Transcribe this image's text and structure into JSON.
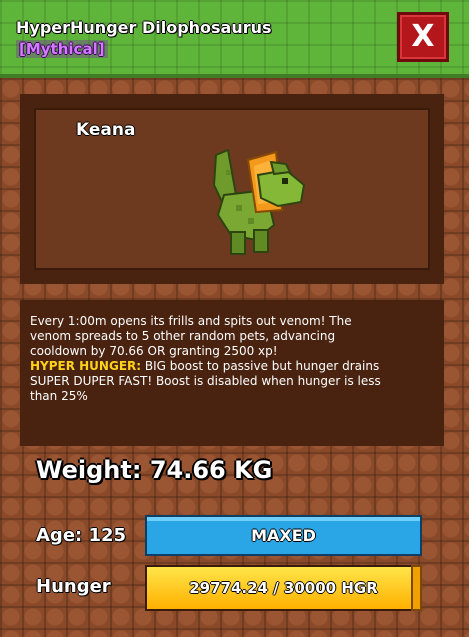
{
  "header": {
    "title": "HyperHunger Dilophosaurus",
    "rarity": "[Mythical]",
    "close_label": "X"
  },
  "pet": {
    "name": "Keana"
  },
  "description": {
    "line1": "Every 1:00m opens its frills and spits out venom! The",
    "line2": "venom spreads to 5 other random pets, advancing",
    "line3": "cooldown by 70.66 OR granting 2500 xp!",
    "hyper_label": "HYPER HUNGER:",
    "line4_rest": " BIG boost to passive but hunger drains",
    "line5": "SUPER DUPER FAST! Boost is disabled when hunger is less",
    "line6": "than 25%"
  },
  "stats": {
    "weight": "Weight: 74.66 KG",
    "age_label": "Age: 125",
    "age_bar_text": "MAXED",
    "hunger_label": "Hunger",
    "hunger_text": "29774.24 / 30000 HGR",
    "hunger_fraction": 0.9925
  },
  "colors": {
    "header_green": "#5fb43a",
    "rarity_purple": "#d27bff",
    "close_red": "#b3171b",
    "age_bar_blue": "#2aa6e6",
    "hunger_yellow": "#ffc400",
    "hyper_yellow": "#ffd21a"
  }
}
